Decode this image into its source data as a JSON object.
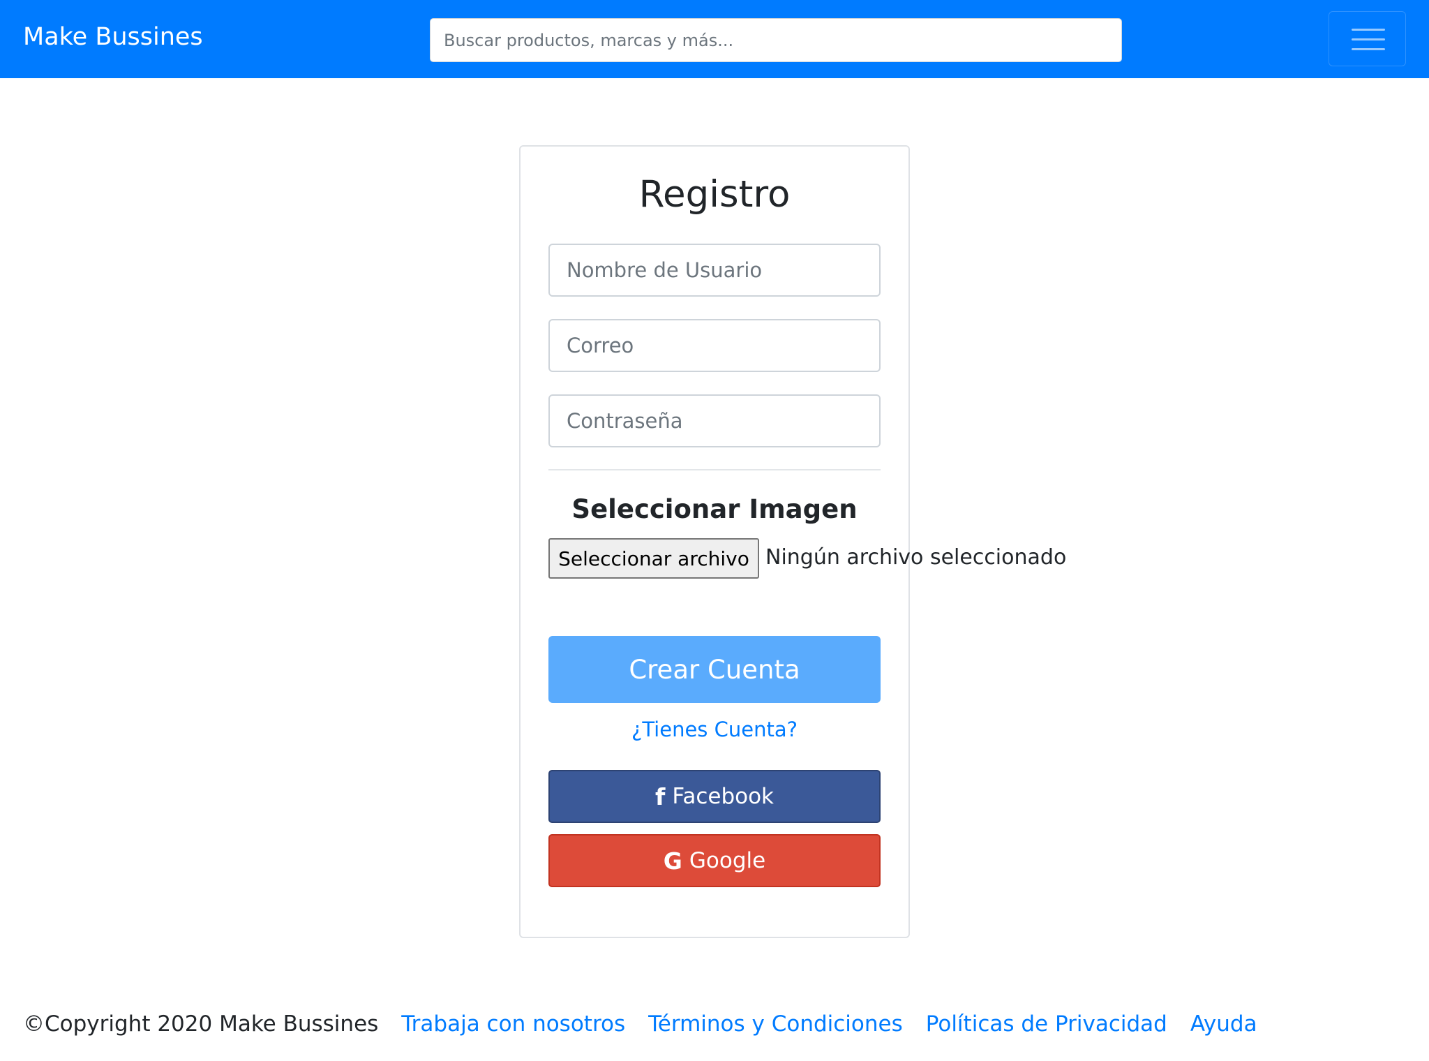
{
  "navbar": {
    "brand": "Make Bussines",
    "search_placeholder": "Buscar productos, marcas y más...",
    "menu_icon": "hamburger-icon"
  },
  "form": {
    "title": "Registro",
    "username_placeholder": "Nombre de Usuario",
    "email_placeholder": "Correo",
    "password_placeholder": "Contraseña",
    "image_heading": "Seleccionar Imagen",
    "file_button": "Seleccionar archivo",
    "file_status": "Ningún archivo seleccionado",
    "submit": "Crear Cuenta",
    "login_link": "¿Tienes Cuenta?"
  },
  "social": {
    "facebook": {
      "icon": "f",
      "label": "Facebook",
      "color": "#3b5998"
    },
    "google": {
      "icon": "G",
      "label": "Google",
      "color": "#dd4b39"
    }
  },
  "footer": {
    "copyright": "©Copyright 2020 Make Bussines",
    "links": [
      "Trabaja con nosotros",
      "Términos y Condiciones",
      "Políticas de Privacidad",
      "Ayuda"
    ]
  },
  "colors": {
    "primary": "#007bff",
    "primary_light": "#5aabfd"
  }
}
